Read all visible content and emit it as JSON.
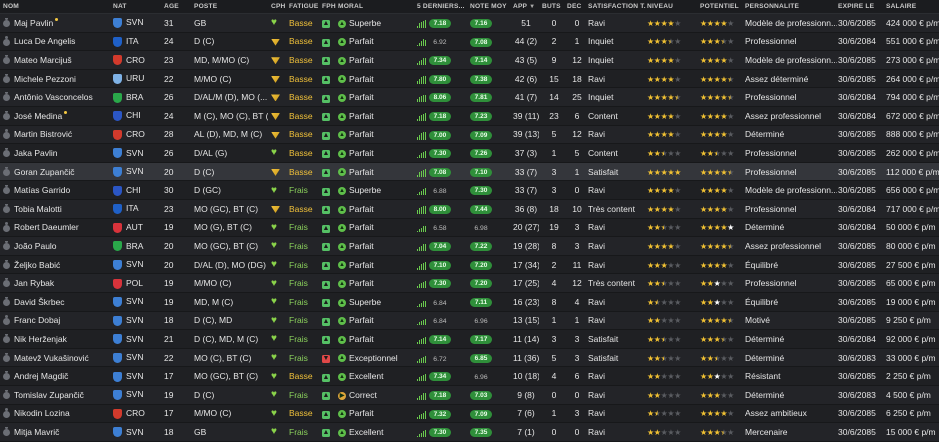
{
  "headers": {
    "nom": "NOM",
    "nat": "NAT",
    "age": "ÂGE",
    "poste": "POSTE",
    "cph": "CPH",
    "fatigue": "FATIGUE",
    "fph": "FPH",
    "moral": "MORAL",
    "derniers": "5 DERNIERS...",
    "note": "NOTE MOY",
    "app": "APP",
    "buts": "BUTS",
    "dec": "DÉC",
    "satisfaction": "SATISFACTION T...",
    "niveau": "NIVEAU",
    "potentiel": "POTENTIEL",
    "personnalite": "PERSONNALITÉ",
    "expire": "EXPIRE LE",
    "salaire": "SALAIRE"
  },
  "colors": {
    "green_pill": "#2f8f3a",
    "star": "#f2c233",
    "basse": "#f0c13a",
    "frais": "#8bd15c"
  },
  "players": [
    {
      "name": "Maj Pavlin",
      "nat": "SVN",
      "age": "31",
      "pos": "GB",
      "cph": "green",
      "fatigue": "Basse",
      "fph": "green",
      "moral": "Superbe",
      "form": [
        3,
        6,
        7,
        8,
        9
      ],
      "last": "7.18",
      "note": "7.16",
      "app": "51",
      "buts": "0",
      "dec": "0",
      "sat": "Ravi",
      "niveau": [
        1,
        1,
        1,
        1,
        0
      ],
      "pot": [
        1,
        1,
        1,
        1,
        0
      ],
      "pers": "Modèle de professionn...",
      "exp": "30/6/2085",
      "sal": "424 000 € p/m",
      "flag": "#3d7fd4",
      "tick": true
    },
    {
      "name": "Luca De Angelis",
      "nat": "ITA",
      "age": "24",
      "pos": "D (C)",
      "cph": "yellow",
      "fatigue": "Basse",
      "fph": "green",
      "moral": "Parfait",
      "form": [
        3,
        5,
        7,
        9,
        8
      ],
      "last": "6.92",
      "note": "7.08",
      "app": "44 (2)",
      "buts": "2",
      "dec": "1",
      "sat": "Inquiet",
      "niveau": [
        1,
        1,
        1,
        0.5,
        0
      ],
      "pot": [
        1,
        1,
        1,
        0.5,
        0
      ],
      "pers": "Professionnel",
      "exp": "30/6/2084",
      "sal": "551 000 € p/m",
      "flag": "#1f60c7",
      "tick": false,
      "last_plain": true
    },
    {
      "name": "Mateo Marcijuš",
      "nat": "CRO",
      "age": "23",
      "pos": "MD, M/MO (C)",
      "cph": "yellow",
      "fatigue": "Basse",
      "fph": "green",
      "moral": "Parfait",
      "form": [
        4,
        6,
        7,
        9,
        9
      ],
      "last": "7.34",
      "note": "7.14",
      "app": "43 (5)",
      "buts": "9",
      "dec": "12",
      "sat": "Inquiet",
      "niveau": [
        1,
        1,
        1,
        1,
        0
      ],
      "pot": [
        1,
        1,
        1,
        1,
        0
      ],
      "pers": "Modèle de professionn...",
      "exp": "30/6/2085",
      "sal": "273 000 € p/m",
      "flag": "#d23a2c",
      "tick": false
    },
    {
      "name": "Michele Pezzoni",
      "nat": "URU",
      "age": "22",
      "pos": "M/MO (C)",
      "cph": "yellow",
      "fatigue": "Basse",
      "fph": "green",
      "moral": "Parfait",
      "form": [
        4,
        6,
        8,
        9,
        9
      ],
      "last": "7.80",
      "note": "7.38",
      "app": "42 (6)",
      "buts": "15",
      "dec": "18",
      "sat": "Ravi",
      "niveau": [
        1,
        1,
        1,
        1,
        0
      ],
      "pot": [
        1,
        1,
        1,
        1,
        0.5
      ],
      "pers": "Assez déterminé",
      "exp": "30/6/2085",
      "sal": "264 000 € p/m",
      "flag": "#7fb2e6",
      "tick": false
    },
    {
      "name": "Antônio Vasconcelos",
      "nat": "BRA",
      "age": "26",
      "pos": "D/AL/M (D), MO (...",
      "cph": "yellow",
      "fatigue": "Basse",
      "fph": "green",
      "moral": "Parfait",
      "form": [
        5,
        7,
        8,
        9,
        9
      ],
      "last": "8.06",
      "note": "7.81",
      "app": "41 (7)",
      "buts": "14",
      "dec": "25",
      "sat": "Inquiet",
      "niveau": [
        1,
        1,
        1,
        1,
        0.5
      ],
      "pot": [
        1,
        1,
        1,
        1,
        0.5
      ],
      "pers": "Professionnel",
      "exp": "30/6/2084",
      "sal": "794 000 € p/m",
      "flag": "#2aa84a",
      "tick": false
    },
    {
      "name": "José Medina",
      "nat": "CHI",
      "age": "24",
      "pos": "M (C), MO (C), BT (C)",
      "cph": "yellow",
      "fatigue": "Basse",
      "fph": "green",
      "moral": "Parfait",
      "form": [
        3,
        6,
        7,
        8,
        9
      ],
      "last": "7.18",
      "note": "7.23",
      "app": "39 (11)",
      "buts": "23",
      "dec": "6",
      "sat": "Content",
      "niveau": [
        1,
        1,
        1,
        1,
        0
      ],
      "pot": [
        1,
        1,
        1,
        1,
        0
      ],
      "pers": "Assez professionnel",
      "exp": "30/6/2084",
      "sal": "672 000 € p/m",
      "flag": "#2b56c4",
      "tick": true
    },
    {
      "name": "Martin Bistrović",
      "nat": "CRO",
      "age": "28",
      "pos": "AL (D), MD, M (C)",
      "cph": "yellow",
      "fatigue": "Basse",
      "fph": "green",
      "moral": "Parfait",
      "form": [
        4,
        6,
        8,
        9,
        9
      ],
      "last": "7.00",
      "note": "7.09",
      "app": "39 (13)",
      "buts": "5",
      "dec": "12",
      "sat": "Ravi",
      "niveau": [
        1,
        1,
        1,
        1,
        0
      ],
      "pot": [
        1,
        1,
        1,
        1,
        0
      ],
      "pers": "Déterminé",
      "exp": "30/6/2085",
      "sal": "888 000 € p/m",
      "flag": "#d23a2c",
      "tick": false
    },
    {
      "name": "Jaka Pavlin",
      "nat": "SVN",
      "age": "26",
      "pos": "D/AL (G)",
      "cph": "green",
      "fatigue": "Basse",
      "fph": "green",
      "moral": "Parfait",
      "form": [
        3,
        5,
        7,
        8,
        9
      ],
      "last": "7.30",
      "note": "7.26",
      "app": "37 (3)",
      "buts": "1",
      "dec": "5",
      "sat": "Content",
      "niveau": [
        1,
        1,
        0.5,
        0,
        0
      ],
      "pot": [
        1,
        1,
        0.5,
        0,
        0
      ],
      "pers": "Professionnel",
      "exp": "30/6/2085",
      "sal": "262 000 € p/m",
      "flag": "#3d7fd4",
      "tick": false
    },
    {
      "name": "Goran Zupančič",
      "nat": "SVN",
      "age": "20",
      "pos": "D (C)",
      "cph": "yellow",
      "fatigue": "Basse",
      "fph": "green",
      "moral": "Parfait",
      "form": [
        3,
        6,
        7,
        8,
        9
      ],
      "last": "7.08",
      "note": "7.10",
      "app": "33 (7)",
      "buts": "3",
      "dec": "1",
      "sat": "Satisfait",
      "niveau": [
        1,
        1,
        1,
        1,
        1
      ],
      "pot": [
        1,
        1,
        1,
        1,
        0.5
      ],
      "pers": "Professionnel",
      "exp": "30/6/2085",
      "sal": "112 000 € p/m",
      "flag": "#3d7fd4",
      "tick": false,
      "selected": true
    },
    {
      "name": "Matías Garrido",
      "nat": "CHI",
      "age": "30",
      "pos": "D (GC)",
      "cph": "green",
      "fatigue": "Frais",
      "fph": "green",
      "moral": "Superbe",
      "form": [
        3,
        5,
        6,
        8,
        9
      ],
      "last": "6.88",
      "note": "7.30",
      "app": "33 (7)",
      "buts": "3",
      "dec": "0",
      "sat": "Ravi",
      "niveau": [
        1,
        1,
        1,
        1,
        0
      ],
      "pot": [
        1,
        1,
        1,
        1,
        0
      ],
      "pers": "Modèle de professionn...",
      "exp": "30/6/2085",
      "sal": "656 000 € p/m",
      "flag": "#2b56c4",
      "tick": false,
      "last_plain": true
    },
    {
      "name": "Tobia Malotti",
      "nat": "ITA",
      "age": "23",
      "pos": "MO (GC), BT (C)",
      "cph": "yellow",
      "fatigue": "Basse",
      "fph": "green",
      "moral": "Parfait",
      "form": [
        5,
        7,
        8,
        9,
        9
      ],
      "last": "8.00",
      "note": "7.44",
      "app": "36 (8)",
      "buts": "18",
      "dec": "10",
      "sat": "Très content",
      "niveau": [
        1,
        1,
        1,
        1,
        0
      ],
      "pot": [
        1,
        1,
        1,
        1,
        0
      ],
      "pers": "Professionnel",
      "exp": "30/6/2084",
      "sal": "717 000 € p/m",
      "flag": "#1f60c7",
      "tick": false
    },
    {
      "name": "Robert Daeumler",
      "nat": "AUT",
      "age": "19",
      "pos": "MO (G), BT (C)",
      "cph": "green",
      "fatigue": "Frais",
      "fph": "green",
      "moral": "Parfait",
      "form": [
        3,
        5,
        6,
        8,
        8
      ],
      "last": "6.58",
      "note": "6.98",
      "app": "20 (27)",
      "buts": "19",
      "dec": "3",
      "sat": "Ravi",
      "niveau": [
        1,
        1,
        0.5,
        0,
        0
      ],
      "pot": [
        1,
        1,
        1,
        1,
        2
      ],
      "pers": "Déterminé",
      "exp": "30/6/2084",
      "sal": "50 000 € p/m",
      "flag": "#d8333b",
      "tick": false,
      "last_plain": true,
      "note_plain": true
    },
    {
      "name": "João Paulo",
      "nat": "BRA",
      "age": "20",
      "pos": "MO (GC), BT (C)",
      "cph": "green",
      "fatigue": "Frais",
      "fph": "green",
      "moral": "Parfait",
      "form": [
        4,
        6,
        7,
        9,
        9
      ],
      "last": "7.04",
      "note": "7.22",
      "app": "19 (28)",
      "buts": "8",
      "dec": "3",
      "sat": "Ravi",
      "niveau": [
        1,
        1,
        1,
        1,
        0
      ],
      "pot": [
        1,
        1,
        1,
        1,
        0.5
      ],
      "pers": "Assez professionnel",
      "exp": "30/6/2085",
      "sal": "80 000 € p/m",
      "flag": "#2aa84a",
      "tick": false
    },
    {
      "name": "Željko Babić",
      "nat": "SVN",
      "age": "20",
      "pos": "D/AL (D), MO (DG)",
      "cph": "green",
      "fatigue": "Frais",
      "fph": "green",
      "moral": "Parfait",
      "form": [
        3,
        5,
        7,
        8,
        9
      ],
      "last": "7.10",
      "note": "7.20",
      "app": "17 (34)",
      "buts": "2",
      "dec": "11",
      "sat": "Ravi",
      "niveau": [
        1,
        1,
        1,
        0,
        0
      ],
      "pot": [
        1,
        1,
        1,
        1,
        0
      ],
      "pers": "Équilibré",
      "exp": "30/6/2085",
      "sal": "27 500 € p/m",
      "flag": "#3d7fd4",
      "tick": false
    },
    {
      "name": "Jan Rybak",
      "nat": "POL",
      "age": "19",
      "pos": "M/MO (C)",
      "cph": "green",
      "fatigue": "Frais",
      "fph": "green",
      "moral": "Parfait",
      "form": [
        4,
        6,
        7,
        8,
        9
      ],
      "last": "7.30",
      "note": "7.20",
      "app": "17 (25)",
      "buts": "4",
      "dec": "12",
      "sat": "Très content",
      "niveau": [
        1,
        1,
        0.5,
        0,
        0
      ],
      "pot": [
        1,
        1,
        2,
        0,
        0
      ],
      "pers": "Professionnel",
      "exp": "30/6/2085",
      "sal": "65 000 € p/m",
      "flag": "#d8333b",
      "tick": false
    },
    {
      "name": "David Škrbec",
      "nat": "SVN",
      "age": "19",
      "pos": "MD, M (C)",
      "cph": "green",
      "fatigue": "Frais",
      "fph": "green",
      "moral": "Superbe",
      "form": [
        3,
        5,
        6,
        8,
        8
      ],
      "last": "6.84",
      "note": "7.11",
      "app": "16 (23)",
      "buts": "8",
      "dec": "4",
      "sat": "Ravi",
      "niveau": [
        1,
        0.5,
        0,
        0,
        0
      ],
      "pot": [
        1,
        1,
        2,
        0,
        0
      ],
      "pers": "Équilibré",
      "exp": "30/6/2085",
      "sal": "19 000 € p/m",
      "flag": "#3d7fd4",
      "tick": false,
      "last_plain": true
    },
    {
      "name": "Franc Dobaj",
      "nat": "SVN",
      "age": "18",
      "pos": "D (C), MD",
      "cph": "green",
      "fatigue": "Frais",
      "fph": "green",
      "moral": "Parfait",
      "form": [
        3,
        5,
        6,
        7,
        8
      ],
      "last": "6.84",
      "note": "6.96",
      "app": "13 (15)",
      "buts": "1",
      "dec": "1",
      "sat": "Ravi",
      "niveau": [
        1,
        1,
        0,
        0,
        0
      ],
      "pot": [
        1,
        1,
        1,
        1,
        0.5
      ],
      "pers": "Motivé",
      "exp": "30/6/2085",
      "sal": "9 250 € p/m",
      "flag": "#3d7fd4",
      "tick": false,
      "last_plain": true,
      "note_plain": true
    },
    {
      "name": "Nik Herženjak",
      "nat": "SVN",
      "age": "21",
      "pos": "D (C), MD, M (C)",
      "cph": "green",
      "fatigue": "Frais",
      "fph": "green",
      "moral": "Parfait",
      "form": [
        4,
        6,
        7,
        8,
        9
      ],
      "last": "7.14",
      "note": "7.17",
      "app": "11 (14)",
      "buts": "3",
      "dec": "3",
      "sat": "Satisfait",
      "niveau": [
        1,
        1,
        0.5,
        0,
        0
      ],
      "pot": [
        1,
        1,
        1,
        0.5,
        0
      ],
      "pers": "Déterminé",
      "exp": "30/6/2084",
      "sal": "92 000 € p/m",
      "flag": "#3d7fd4",
      "tick": false
    },
    {
      "name": "Matevž Vukašinović",
      "nat": "SVN",
      "age": "22",
      "pos": "MO (C), BT (C)",
      "cph": "green",
      "fatigue": "Frais",
      "fph": "red",
      "moral": "Exceptionnel",
      "form": [
        3,
        5,
        6,
        7,
        8
      ],
      "last": "6.72",
      "note": "6.85",
      "app": "11 (36)",
      "buts": "5",
      "dec": "3",
      "sat": "Satisfait",
      "niveau": [
        1,
        1,
        0.5,
        0,
        0
      ],
      "pot": [
        1,
        1,
        0.5,
        0,
        0
      ],
      "pers": "Déterminé",
      "exp": "30/6/2083",
      "sal": "33 000 € p/m",
      "flag": "#3d7fd4",
      "tick": false,
      "last_plain": true
    },
    {
      "name": "Andrej Magdič",
      "nat": "SVN",
      "age": "17",
      "pos": "MO (GC), BT (C)",
      "cph": "green",
      "fatigue": "Basse",
      "fph": "green",
      "moral": "Excellent",
      "form": [
        4,
        6,
        7,
        8,
        9
      ],
      "last": "7.34",
      "note": "6.96",
      "app": "10 (18)",
      "buts": "4",
      "dec": "6",
      "sat": "Ravi",
      "niveau": [
        1,
        1,
        0,
        0,
        0
      ],
      "pot": [
        1,
        1,
        2,
        0,
        0
      ],
      "pers": "Résistant",
      "exp": "30/6/2085",
      "sal": "2 250 € p/m",
      "flag": "#3d7fd4",
      "tick": false,
      "note_plain": true
    },
    {
      "name": "Tomislav Zupančič",
      "nat": "SVN",
      "age": "19",
      "pos": "D (C)",
      "cph": "green",
      "fatigue": "Frais",
      "fph": "green",
      "moral": "Correct",
      "form": [
        3,
        5,
        6,
        8,
        8
      ],
      "last": "7.18",
      "note": "7.03",
      "app": "9 (8)",
      "buts": "0",
      "dec": "0",
      "sat": "Ravi",
      "niveau": [
        1,
        1,
        0,
        0,
        0
      ],
      "pot": [
        1,
        1,
        1,
        0,
        0
      ],
      "pers": "Déterminé",
      "exp": "30/6/2083",
      "sal": "4 500 € p/m",
      "flag": "#3d7fd4",
      "tick": false,
      "moral_down": true
    },
    {
      "name": "Nikodin Lozina",
      "nat": "CRO",
      "age": "17",
      "pos": "M/MO (C)",
      "cph": "green",
      "fatigue": "Basse",
      "fph": "green",
      "moral": "Parfait",
      "form": [
        3,
        5,
        6,
        7,
        9
      ],
      "last": "7.32",
      "note": "7.09",
      "app": "7 (6)",
      "buts": "1",
      "dec": "3",
      "sat": "Ravi",
      "niveau": [
        1,
        0.5,
        0,
        0,
        0
      ],
      "pot": [
        1,
        1,
        1,
        1,
        0
      ],
      "pers": "Assez ambitieux",
      "exp": "30/6/2085",
      "sal": "6 250 € p/m",
      "flag": "#d23a2c",
      "tick": false
    },
    {
      "name": "Mitja Mavrič",
      "nat": "SVN",
      "age": "18",
      "pos": "GB",
      "cph": "green",
      "fatigue": "Frais",
      "fph": "green",
      "moral": "Excellent",
      "form": [
        3,
        5,
        6,
        8,
        9
      ],
      "last": "7.30",
      "note": "7.35",
      "app": "7 (1)",
      "buts": "0",
      "dec": "0",
      "sat": "Ravi",
      "niveau": [
        1,
        1,
        0,
        0,
        0
      ],
      "pot": [
        1,
        1,
        1,
        0.5,
        0
      ],
      "pers": "Mercenaire",
      "exp": "30/6/2085",
      "sal": "15 000 € p/m",
      "flag": "#3d7fd4",
      "tick": false
    }
  ]
}
